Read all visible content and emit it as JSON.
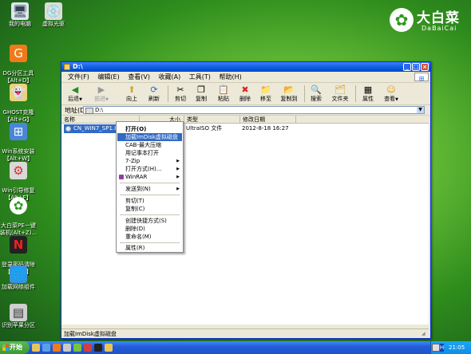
{
  "desktop": {
    "icons": [
      {
        "label": "我的电脑",
        "icon": "computer-icon"
      },
      {
        "label": "虚拟光驱",
        "icon": "cd-drive-icon"
      },
      {
        "label": "DG分区工具\n【Alt+D】",
        "icon": "disk-genius-icon"
      },
      {
        "label": "GHOST克隆\n【Alt+G】",
        "icon": "ghost-icon"
      },
      {
        "label": "Win系统安装\n【Alt+W】",
        "icon": "win-install-icon"
      },
      {
        "label": "Win引导修复\n【Alt+F】",
        "icon": "boot-repair-icon"
      },
      {
        "label": "大白菜PE一键\n装机(Alt+Z)...",
        "icon": "dabaicai-install-icon"
      },
      {
        "label": "登录密码清除\n【Alt+P】",
        "icon": "password-clear-icon"
      },
      {
        "label": "加载网络组件",
        "icon": "network-icon"
      },
      {
        "label": "识别苹果分区",
        "icon": "apple-partition-icon"
      }
    ],
    "logo": {
      "cn": "大白菜",
      "en": "DaBaiCai"
    }
  },
  "window": {
    "title": "D:\\",
    "menu": [
      "文件(F)",
      "编辑(E)",
      "查看(V)",
      "收藏(A)",
      "工具(T)",
      "帮助(H)"
    ],
    "toolbar": [
      {
        "label": "后退",
        "icon": "back-arrow-icon"
      },
      {
        "label": "前进",
        "icon": "forward-arrow-icon"
      },
      {
        "label": "向上",
        "icon": "up-folder-icon"
      },
      {
        "label": "刷新",
        "icon": "refresh-icon"
      },
      {
        "label": "剪切",
        "icon": "cut-icon"
      },
      {
        "label": "复制",
        "icon": "copy-icon"
      },
      {
        "label": "粘贴",
        "icon": "paste-icon"
      },
      {
        "label": "删除",
        "icon": "delete-icon"
      },
      {
        "label": "移至",
        "icon": "move-to-icon"
      },
      {
        "label": "复制到",
        "icon": "copy-to-icon"
      },
      {
        "label": "搜索",
        "icon": "search-icon"
      },
      {
        "label": "文件夹",
        "icon": "folders-icon"
      },
      {
        "label": "属性",
        "icon": "properties-icon"
      },
      {
        "label": "查看",
        "icon": "views-icon"
      }
    ],
    "address": {
      "label": "地址(D)",
      "value": "D:\\"
    },
    "columns": [
      "名称",
      "大小",
      "类型",
      "修改日期"
    ],
    "file": {
      "name": "CN_WIN7_SP1.ISO",
      "type": "UltraISO 文件",
      "modified": "2012-8-18 16:27"
    },
    "status": "加载ImDisk虚拟磁盘"
  },
  "context_menu": {
    "items": [
      {
        "label": "打开(O)",
        "bold": true
      },
      {
        "label": "加载ImDisk虚拟磁盘",
        "highlighted": true
      },
      {
        "label": "CAB-最大压缩"
      },
      {
        "label": "用记事本打开"
      },
      {
        "label": "7-Zip",
        "submenu": true
      },
      {
        "label": "打开方式(H)...",
        "submenu": true
      },
      {
        "label": "WinRAR",
        "submenu": true
      },
      {
        "label": "发送到(N)",
        "submenu": true
      },
      {
        "label": "剪切(T)"
      },
      {
        "label": "复制(C)"
      },
      {
        "label": "创建快捷方式(S)"
      },
      {
        "label": "删除(D)"
      },
      {
        "label": "重命名(M)"
      },
      {
        "label": "属性(R)"
      }
    ]
  },
  "taskbar": {
    "start": "开始",
    "lang": "CH",
    "clock": "21:05"
  },
  "colors": {
    "selection": "#316ac5",
    "titlebar": "#0a5ce0",
    "taskbar": "#245edb"
  }
}
